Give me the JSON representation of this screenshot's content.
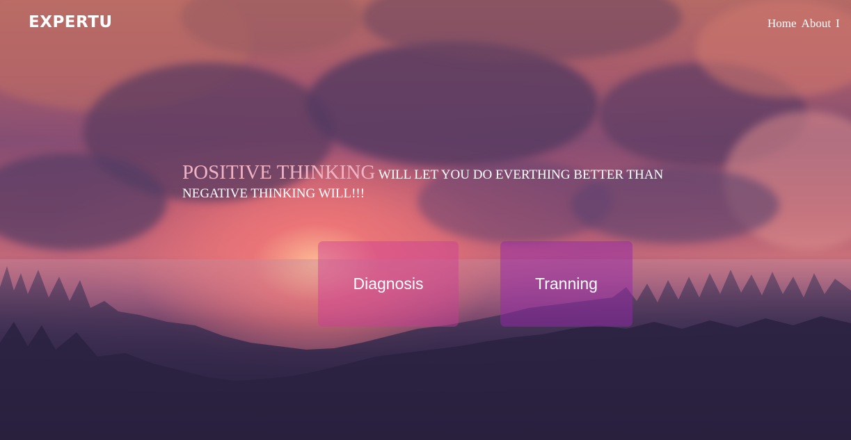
{
  "brand": {
    "logo_text": "EXPERTU"
  },
  "nav": {
    "items": [
      "Home",
      "About",
      "I"
    ]
  },
  "hero": {
    "headline_accent": "POSITIVE THINKING",
    "headline_rest": " WILL LET YOU DO EVERTHING BETTER THAN NEGATIVE THINKING WILL!!!"
  },
  "actions": {
    "diagnosis_label": "Diagnosis",
    "training_label": "Tranning"
  },
  "colors": {
    "accent_text": "#f1b3c3",
    "diagnosis_button": "#cd3c96",
    "training_button": "#9628aa"
  }
}
